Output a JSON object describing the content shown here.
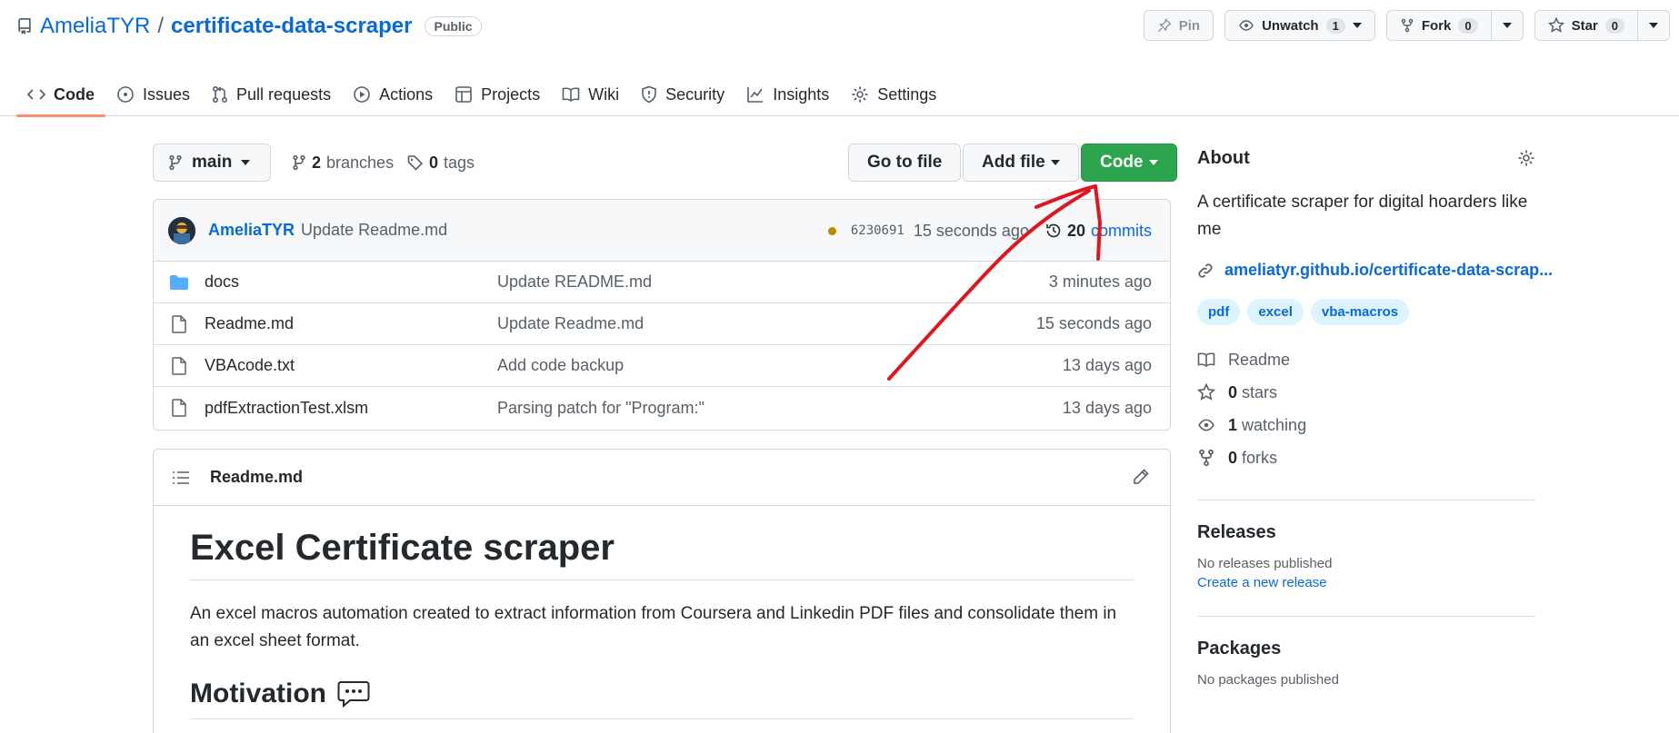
{
  "repo": {
    "owner": "AmeliaTYR",
    "separator": "/",
    "name": "certificate-data-scraper",
    "visibility": "Public"
  },
  "actions": {
    "pin": "Pin",
    "unwatch": "Unwatch",
    "watch_count": "1",
    "fork": "Fork",
    "fork_count": "0",
    "star": "Star",
    "star_count": "0"
  },
  "tabs": [
    {
      "label": "Code",
      "icon": "code-icon",
      "active": true
    },
    {
      "label": "Issues",
      "icon": "issue-icon"
    },
    {
      "label": "Pull requests",
      "icon": "pull-request-icon"
    },
    {
      "label": "Actions",
      "icon": "play-icon"
    },
    {
      "label": "Projects",
      "icon": "table-icon"
    },
    {
      "label": "Wiki",
      "icon": "book-icon"
    },
    {
      "label": "Security",
      "icon": "shield-icon"
    },
    {
      "label": "Insights",
      "icon": "graph-icon"
    },
    {
      "label": "Settings",
      "icon": "gear-icon"
    }
  ],
  "filenav": {
    "branch": "main",
    "branch_count": "2",
    "branches_label": "branches",
    "tag_count": "0",
    "tags_label": "tags",
    "go_to_file": "Go to file",
    "add_file": "Add file",
    "code": "Code"
  },
  "latest_commit": {
    "author": "AmeliaTYR",
    "message": "Update Readme.md",
    "sha": "6230691",
    "time": "15 seconds ago",
    "count": "20",
    "count_label": "commits"
  },
  "files": [
    {
      "name": "docs",
      "type": "folder",
      "message": "Update README.md",
      "age": "3 minutes ago"
    },
    {
      "name": "Readme.md",
      "type": "file",
      "message": "Update Readme.md",
      "age": "15 seconds ago"
    },
    {
      "name": "VBAcode.txt",
      "type": "file",
      "message": "Add code backup",
      "age": "13 days ago"
    },
    {
      "name": "pdfExtractionTest.xlsm",
      "type": "file",
      "message": "Parsing patch for \"Program:\"",
      "age": "13 days ago"
    }
  ],
  "readme": {
    "filename": "Readme.md",
    "heading": "Excel Certificate scraper",
    "paragraph": "An excel macros automation created to extract information from Coursera and Linkedin PDF files and consolidate them in an excel sheet format.",
    "subheading": "Motivation"
  },
  "about": {
    "title": "About",
    "description": "A certificate scraper for digital hoarders like me",
    "link": "ameliatyr.github.io/certificate-data-scrap...",
    "topics": [
      "pdf",
      "excel",
      "vba-macros"
    ],
    "readme_label": "Readme",
    "stars_count": "0",
    "stars_label": "stars",
    "watching_count": "1",
    "watching_label": "watching",
    "forks_count": "0",
    "forks_label": "forks"
  },
  "releases": {
    "title": "Releases",
    "empty": "No releases published",
    "create": "Create a new release"
  },
  "packages": {
    "title": "Packages",
    "empty": "No packages published"
  },
  "colors": {
    "accent_link": "#0969da",
    "code_button": "#2da44e",
    "active_tab_underline": "#fd8c73",
    "annotation_arrow": "#e0161e"
  }
}
